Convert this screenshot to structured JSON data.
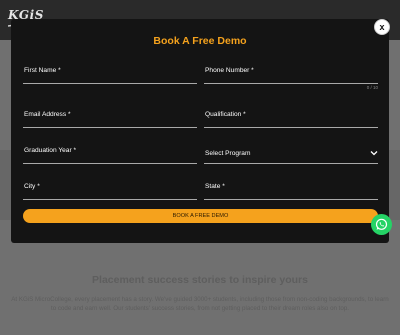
{
  "background": {
    "logo_text": "KGiS",
    "section_heading": "Placement success stories to inspire yours",
    "section_paragraph": "At KGiS MicroCollege, every placement has a story. We've guided 3000+ students, including those from non-coding backgrounds, to learn to code and earn well. Our students' success stories, from not getting placed to their dream roles also on top."
  },
  "modal": {
    "title": "Book A Free Demo",
    "close_label": "x",
    "fields": {
      "first_name": "First Name *",
      "phone_number": "Phone Number *",
      "phone_counter": "0 / 10",
      "email": "Email Address *",
      "qualification": "Qualification *",
      "graduation_year": "Graduation Year *",
      "program": "Select Program",
      "city": "City *",
      "state": "State *"
    },
    "submit_label": "BOOK A FREE DEMO"
  },
  "colors": {
    "accent": "#f5a21d",
    "modal_bg": "#141414",
    "whatsapp": "#25d366"
  },
  "icons": {
    "close": "close-icon",
    "select": "chevron-down-icon",
    "whatsapp": "whatsapp-icon"
  }
}
